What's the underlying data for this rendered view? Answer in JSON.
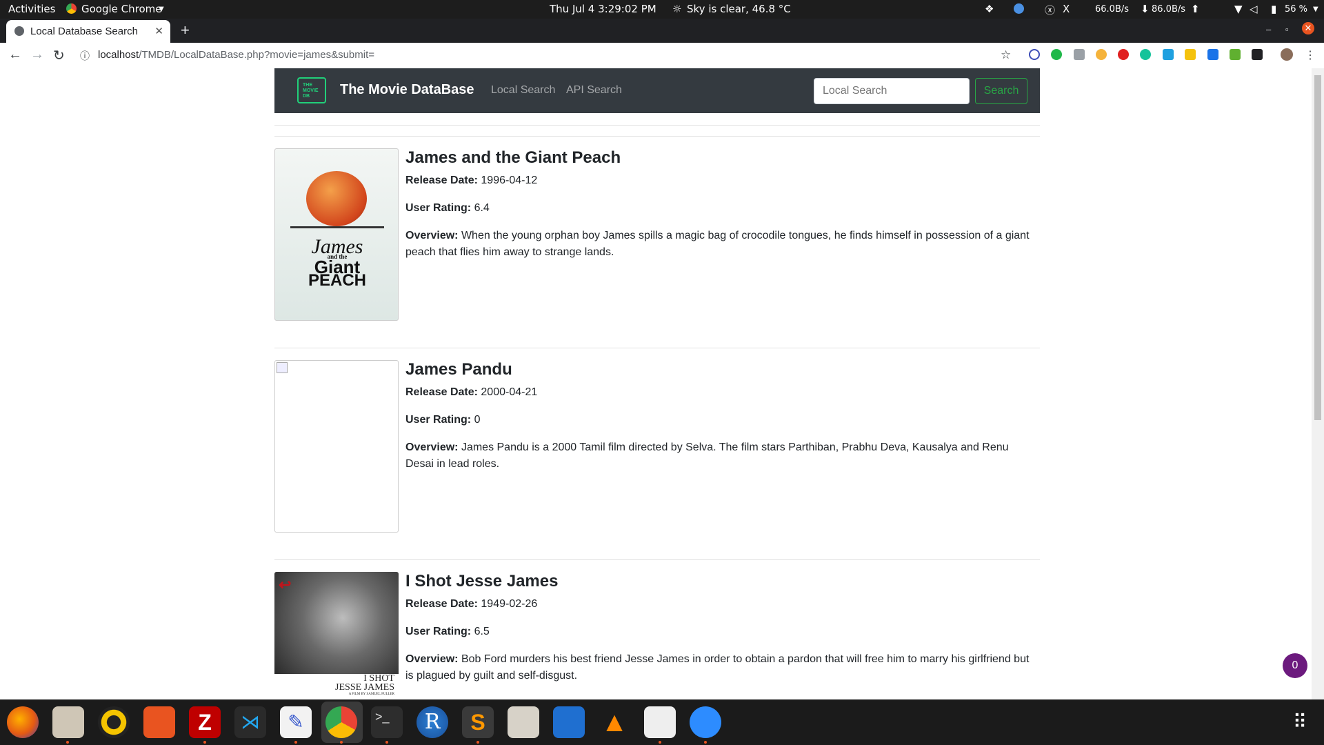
{
  "topbar": {
    "activities": "Activities",
    "app_menu": "Google Chrome",
    "datetime": "Thu Jul 4   3:29:02 PM",
    "weather": "Sky is clear, 46.8 °C",
    "x_label": "X",
    "net_down": "66.0B/s",
    "net_up": "86.0B/s",
    "battery": "56 %"
  },
  "browser": {
    "tab_title": "Local Database Search",
    "url_host": "localhost",
    "url_path": "/TMDB/LocalDataBase.php?movie=james&submit="
  },
  "navbar": {
    "brand": "The Movie DataBase",
    "logo_text": "THE MOVIE DB",
    "links": [
      "Local Search",
      "API Search"
    ],
    "search_placeholder": "Local Search",
    "search_button": "Search"
  },
  "labels": {
    "release": "Release Date:",
    "rating": "User Rating:",
    "overview": "Overview:"
  },
  "movies": [
    {
      "title": "James and the Giant Peach",
      "release_date": "1996-04-12",
      "rating": "6.4",
      "overview": "When the young orphan boy James spills a magic bag of crocodile tongues, he finds himself in possession of a giant peach that flies him away to strange lands.",
      "poster_text": [
        "James",
        "and the",
        "Giant",
        "PEACH"
      ]
    },
    {
      "title": "James Pandu",
      "release_date": "2000-04-21",
      "rating": "0",
      "overview": "James Pandu is a 2000 Tamil film directed by Selva. The film stars Parthiban, Prabhu Deva, Kausalya and Renu Desai in lead roles."
    },
    {
      "title": "I Shot Jesse James",
      "release_date": "1949-02-26",
      "rating": "6.5",
      "overview": "Bob Ford murders his best friend Jesse James in order to obtain a pardon that will free him to marry his girlfriend but is plagued by guilt and self-disgust.",
      "poster_text": [
        "I SHOT",
        "JESSE JAMES",
        "A FILM BY SAMUEL FULLER"
      ]
    }
  ],
  "badge_count": "0"
}
